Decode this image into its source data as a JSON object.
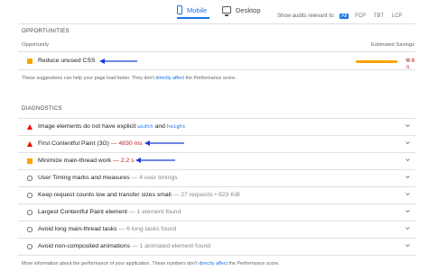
{
  "tabs": [
    {
      "label": "Mobile",
      "active": true,
      "icon": "phone-icon"
    },
    {
      "label": "Desktop",
      "active": false,
      "icon": "monitor-icon"
    }
  ],
  "audits_filter": {
    "label": "Show audits relevant to:",
    "chips": [
      {
        "label": "All",
        "active": true
      },
      {
        "label": "FCP",
        "active": false
      },
      {
        "label": "TBT",
        "active": false
      },
      {
        "label": "LCP",
        "active": false
      }
    ]
  },
  "opportunities": {
    "heading": "OPPORTUNITIES",
    "col_left": "Opportunity",
    "col_right": "Estimated Savings",
    "items": [
      {
        "status": "average",
        "title": "Reduce unused CSS",
        "savings": "0.6 s",
        "savings_bar_fraction": 0.8
      }
    ],
    "note_before": "These suggestions can help your page load faster. They don't",
    "note_link": "directly affect",
    "note_after": "the Performance score."
  },
  "diagnostics": {
    "heading": "DIAGNOSTICS",
    "items": [
      {
        "status": "fail",
        "title": "Image elements do not have explicit",
        "code1": "width",
        "and": "and",
        "code2": "height",
        "detail": ""
      },
      {
        "status": "fail",
        "title": "First Contentful Paint (3G)",
        "sep": "—",
        "detail": "4830 ms"
      },
      {
        "status": "average",
        "title": "Minimize main-thread work",
        "sep": "—",
        "detail": "2.2 s"
      },
      {
        "status": "info",
        "title": "User Timing marks and measures",
        "sep": "—",
        "detail": "4 user timings"
      },
      {
        "status": "info",
        "title": "Keep request counts low and transfer sizes small",
        "sep": "—",
        "detail": "27 requests • 823 KiB"
      },
      {
        "status": "info",
        "title": "Largest Contentful Paint element",
        "sep": "—",
        "detail": "1 element found"
      },
      {
        "status": "info",
        "title": "Avoid long main-thread tasks",
        "sep": "—",
        "detail": "6 long tasks found"
      },
      {
        "status": "info",
        "title": "Avoid non-composited animations",
        "sep": "—",
        "detail": "1 animated element found"
      }
    ],
    "note_before": "More information about the performance of your application. These numbers don't",
    "note_link": "directly affect",
    "note_after": "the Performance score."
  },
  "colors": {
    "accent": "#1a73e8",
    "fail": "#eb0f00",
    "average": "#ffa400"
  }
}
